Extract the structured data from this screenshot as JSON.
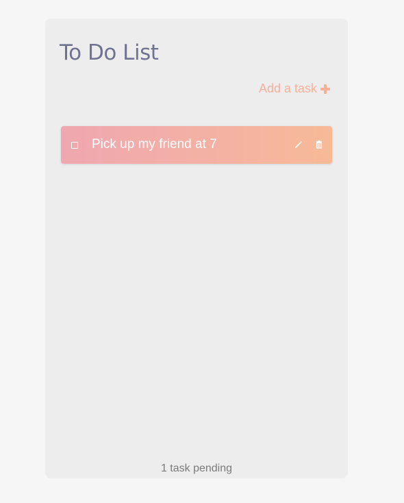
{
  "app": {
    "title": "To Do List",
    "add_task_label": "Add a task",
    "add_task_icon": "plus-icon"
  },
  "tasks": [
    {
      "text": "Pick up my friend at 7",
      "completed": false,
      "edit_icon": "pencil-icon",
      "delete_icon": "trash-icon"
    }
  ],
  "footer": {
    "pending_text": "1 task pending"
  },
  "colors": {
    "background": "#f6f6f6",
    "panel": "#ededed",
    "title": "#6f7391",
    "accent": "#f5b09a",
    "task_gradient_start": "#f0a7b0",
    "task_gradient_end": "#f7ba97",
    "footer_text": "#7a7a7a"
  }
}
